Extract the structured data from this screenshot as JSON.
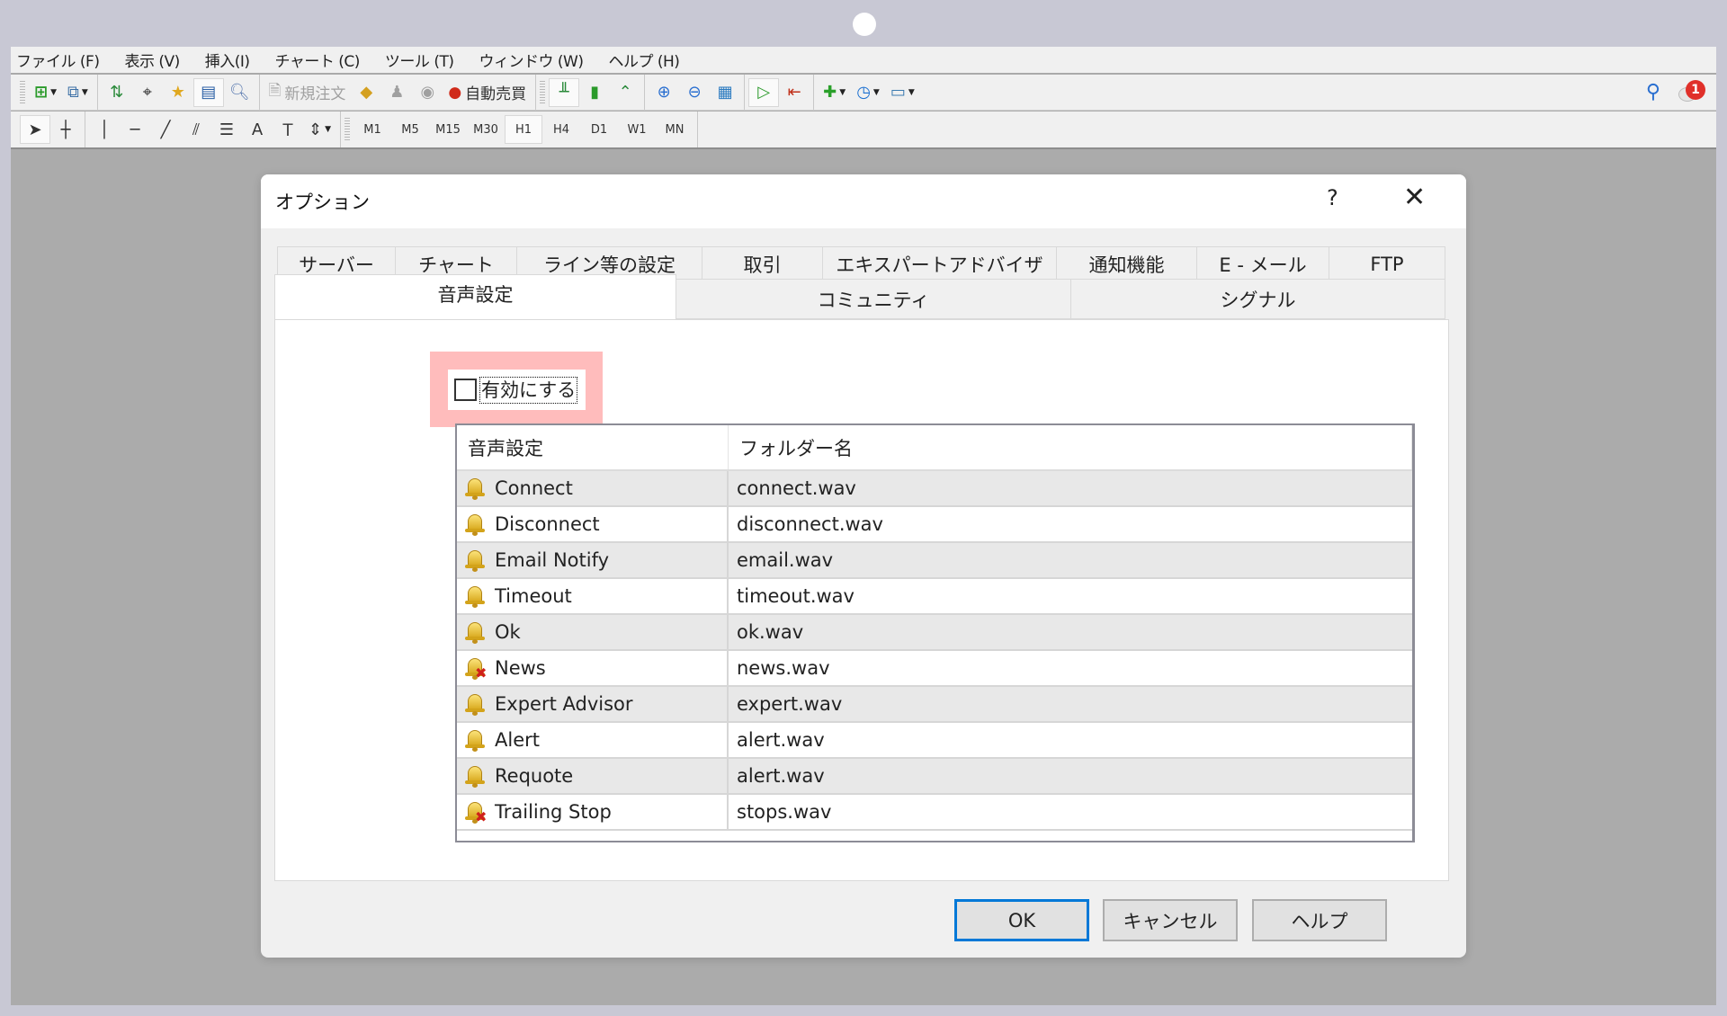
{
  "menu": [
    "ファイル (F)",
    "表示 (V)",
    "挿入(I)",
    "チャート (C)",
    "ツール (T)",
    "ウィンドウ (W)",
    "ヘルプ (H)"
  ],
  "toolbar1": {
    "new_order_label": "新規注文",
    "auto_trading_label": "自動売買",
    "notification_count": "1"
  },
  "toolbar2": {
    "timeframes": [
      "M1",
      "M5",
      "M15",
      "M30",
      "H1",
      "H4",
      "D1",
      "W1",
      "MN"
    ],
    "active_timeframe": "H1"
  },
  "dialog": {
    "title": "オプション",
    "help_glyph": "?",
    "close_glyph": "✕",
    "tabs_row1": [
      "サーバー",
      "チャート",
      "ライン等の設定",
      "取引",
      "エキスパートアドバイザ",
      "通知機能",
      "E - メール",
      "FTP"
    ],
    "tabs_row2": [
      "音声設定",
      "コミュニティ",
      "シグナル"
    ],
    "active_tab": "音声設定",
    "enable_checkbox": {
      "label": "有効にする",
      "checked": false
    },
    "table": {
      "headers": [
        "音声設定",
        "フォルダー名"
      ],
      "rows": [
        {
          "event": "Connect",
          "file": "connect.wav",
          "enabled": true
        },
        {
          "event": "Disconnect",
          "file": "disconnect.wav",
          "enabled": true
        },
        {
          "event": "Email Notify",
          "file": "email.wav",
          "enabled": true
        },
        {
          "event": "Timeout",
          "file": "timeout.wav",
          "enabled": true
        },
        {
          "event": "Ok",
          "file": "ok.wav",
          "enabled": true
        },
        {
          "event": "News",
          "file": "news.wav",
          "enabled": false
        },
        {
          "event": "Expert Advisor",
          "file": "expert.wav",
          "enabled": true
        },
        {
          "event": "Alert",
          "file": "alert.wav",
          "enabled": true
        },
        {
          "event": "Requote",
          "file": "alert.wav",
          "enabled": true
        },
        {
          "event": "Trailing Stop",
          "file": "stops.wav",
          "enabled": false
        }
      ]
    },
    "buttons": {
      "ok": "OK",
      "cancel": "キャンセル",
      "help": "ヘルプ"
    }
  },
  "colors": {
    "highlight": "#ffbcbc",
    "default_button_border": "#0078d7",
    "badge": "#e0302a"
  }
}
